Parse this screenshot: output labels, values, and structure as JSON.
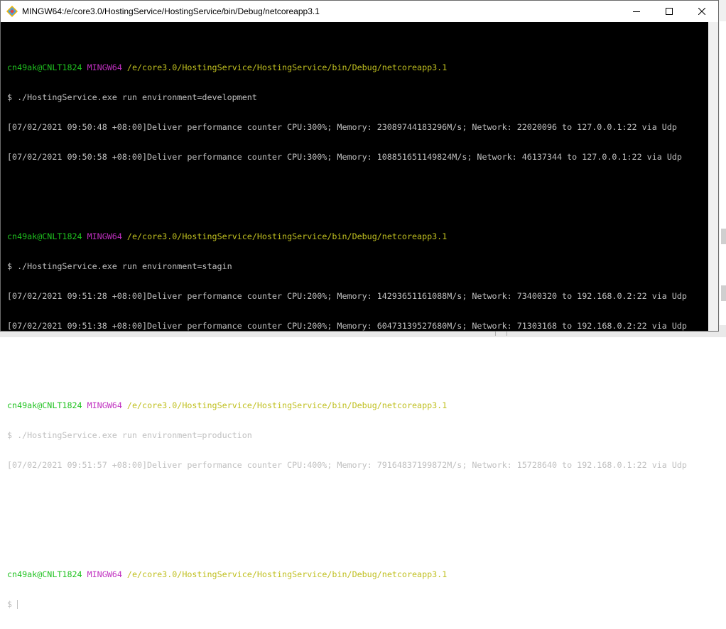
{
  "window": {
    "title": "MINGW64:/e/core3.0/HostingService/HostingService/bin/Debug/netcoreapp3.1"
  },
  "terminal": {
    "blocks": [
      {
        "prompt_user": "cn49ak@CNLT1824",
        "prompt_host": "MINGW64",
        "prompt_path": "/e/core3.0/HostingService/HostingService/bin/Debug/netcoreapp3.1",
        "command": "$ ./HostingService.exe run environment=development",
        "output": [
          "[07/02/2021 09:50:48 +08:00]Deliver performance counter CPU:300%; Memory: 23089744183296M/s; Network: 22020096 to 127.0.0.1:22 via Udp",
          "[07/02/2021 09:50:58 +08:00]Deliver performance counter CPU:300%; Memory: 108851651149824M/s; Network: 46137344 to 127.0.0.1:22 via Udp"
        ]
      },
      {
        "prompt_user": "cn49ak@CNLT1824",
        "prompt_host": "MINGW64",
        "prompt_path": "/e/core3.0/HostingService/HostingService/bin/Debug/netcoreapp3.1",
        "command": "$ ./HostingService.exe run environment=stagin",
        "output": [
          "[07/02/2021 09:51:28 +08:00]Deliver performance counter CPU:200%; Memory: 14293651161088M/s; Network: 73400320 to 192.168.0.2:22 via Udp",
          "[07/02/2021 09:51:38 +08:00]Deliver performance counter CPU:200%; Memory: 60473139527680M/s; Network: 71303168 to 192.168.0.2:22 via Udp"
        ]
      },
      {
        "prompt_user": "cn49ak@CNLT1824",
        "prompt_host": "MINGW64",
        "prompt_path": "/e/core3.0/HostingService/HostingService/bin/Debug/netcoreapp3.1",
        "command": "$ ./HostingService.exe run environment=production",
        "output": [
          "[07/02/2021 09:51:57 +08:00]Deliver performance counter CPU:400%; Memory: 79164837199872M/s; Network: 15728640 to 192.168.0.1:22 via Udp"
        ]
      }
    ],
    "final_prompt": {
      "prompt_user": "cn49ak@CNLT1824",
      "prompt_host": "MINGW64",
      "prompt_path": "/e/core3.0/HostingService/HostingService/bin/Debug/netcoreapp3.1",
      "input_prefix": "$"
    }
  },
  "colors": {
    "user": "#1fc21f",
    "host": "#c030c0",
    "path": "#c0c020",
    "text": "#c0c0c0",
    "background": "#000000"
  },
  "icons": {
    "app": "mingw-diamond-icon",
    "minimize": "minimize-icon",
    "maximize": "maximize-icon",
    "close": "close-icon"
  }
}
